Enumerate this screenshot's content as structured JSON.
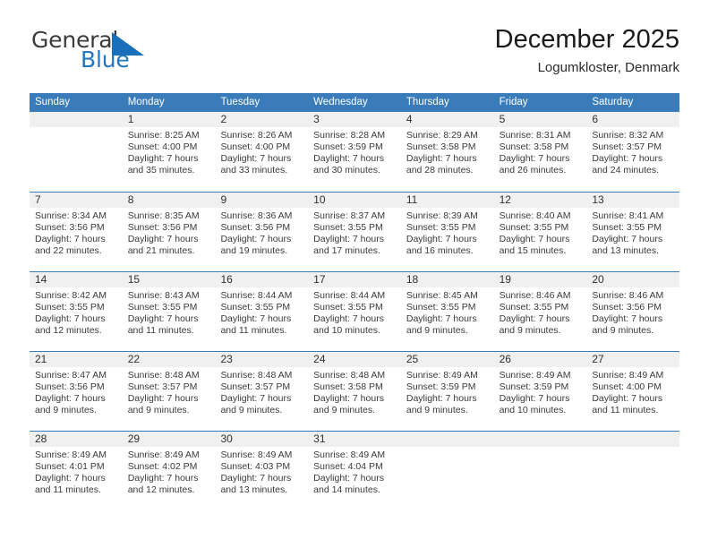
{
  "brand": {
    "name_part1": "General",
    "name_part2": "Blue",
    "mark_icon": "blue-triangle-logo-icon",
    "accent_color": "#2476bd"
  },
  "header": {
    "title": "December 2025",
    "subtitle": "Logumkloster, Denmark"
  },
  "calendar": {
    "header_bg": "#3a7cba",
    "day_band_bg": "#f0f0f0",
    "weekdays": [
      "Sunday",
      "Monday",
      "Tuesday",
      "Wednesday",
      "Thursday",
      "Friday",
      "Saturday"
    ],
    "weeks": [
      [
        {
          "day": "",
          "lines": []
        },
        {
          "day": "1",
          "lines": [
            "Sunrise: 8:25 AM",
            "Sunset: 4:00 PM",
            "Daylight: 7 hours",
            "and 35 minutes."
          ]
        },
        {
          "day": "2",
          "lines": [
            "Sunrise: 8:26 AM",
            "Sunset: 4:00 PM",
            "Daylight: 7 hours",
            "and 33 minutes."
          ]
        },
        {
          "day": "3",
          "lines": [
            "Sunrise: 8:28 AM",
            "Sunset: 3:59 PM",
            "Daylight: 7 hours",
            "and 30 minutes."
          ]
        },
        {
          "day": "4",
          "lines": [
            "Sunrise: 8:29 AM",
            "Sunset: 3:58 PM",
            "Daylight: 7 hours",
            "and 28 minutes."
          ]
        },
        {
          "day": "5",
          "lines": [
            "Sunrise: 8:31 AM",
            "Sunset: 3:58 PM",
            "Daylight: 7 hours",
            "and 26 minutes."
          ]
        },
        {
          "day": "6",
          "lines": [
            "Sunrise: 8:32 AM",
            "Sunset: 3:57 PM",
            "Daylight: 7 hours",
            "and 24 minutes."
          ]
        }
      ],
      [
        {
          "day": "7",
          "lines": [
            "Sunrise: 8:34 AM",
            "Sunset: 3:56 PM",
            "Daylight: 7 hours",
            "and 22 minutes."
          ]
        },
        {
          "day": "8",
          "lines": [
            "Sunrise: 8:35 AM",
            "Sunset: 3:56 PM",
            "Daylight: 7 hours",
            "and 21 minutes."
          ]
        },
        {
          "day": "9",
          "lines": [
            "Sunrise: 8:36 AM",
            "Sunset: 3:56 PM",
            "Daylight: 7 hours",
            "and 19 minutes."
          ]
        },
        {
          "day": "10",
          "lines": [
            "Sunrise: 8:37 AM",
            "Sunset: 3:55 PM",
            "Daylight: 7 hours",
            "and 17 minutes."
          ]
        },
        {
          "day": "11",
          "lines": [
            "Sunrise: 8:39 AM",
            "Sunset: 3:55 PM",
            "Daylight: 7 hours",
            "and 16 minutes."
          ]
        },
        {
          "day": "12",
          "lines": [
            "Sunrise: 8:40 AM",
            "Sunset: 3:55 PM",
            "Daylight: 7 hours",
            "and 15 minutes."
          ]
        },
        {
          "day": "13",
          "lines": [
            "Sunrise: 8:41 AM",
            "Sunset: 3:55 PM",
            "Daylight: 7 hours",
            "and 13 minutes."
          ]
        }
      ],
      [
        {
          "day": "14",
          "lines": [
            "Sunrise: 8:42 AM",
            "Sunset: 3:55 PM",
            "Daylight: 7 hours",
            "and 12 minutes."
          ]
        },
        {
          "day": "15",
          "lines": [
            "Sunrise: 8:43 AM",
            "Sunset: 3:55 PM",
            "Daylight: 7 hours",
            "and 11 minutes."
          ]
        },
        {
          "day": "16",
          "lines": [
            "Sunrise: 8:44 AM",
            "Sunset: 3:55 PM",
            "Daylight: 7 hours",
            "and 11 minutes."
          ]
        },
        {
          "day": "17",
          "lines": [
            "Sunrise: 8:44 AM",
            "Sunset: 3:55 PM",
            "Daylight: 7 hours",
            "and 10 minutes."
          ]
        },
        {
          "day": "18",
          "lines": [
            "Sunrise: 8:45 AM",
            "Sunset: 3:55 PM",
            "Daylight: 7 hours",
            "and 9 minutes."
          ]
        },
        {
          "day": "19",
          "lines": [
            "Sunrise: 8:46 AM",
            "Sunset: 3:55 PM",
            "Daylight: 7 hours",
            "and 9 minutes."
          ]
        },
        {
          "day": "20",
          "lines": [
            "Sunrise: 8:46 AM",
            "Sunset: 3:56 PM",
            "Daylight: 7 hours",
            "and 9 minutes."
          ]
        }
      ],
      [
        {
          "day": "21",
          "lines": [
            "Sunrise: 8:47 AM",
            "Sunset: 3:56 PM",
            "Daylight: 7 hours",
            "and 9 minutes."
          ]
        },
        {
          "day": "22",
          "lines": [
            "Sunrise: 8:48 AM",
            "Sunset: 3:57 PM",
            "Daylight: 7 hours",
            "and 9 minutes."
          ]
        },
        {
          "day": "23",
          "lines": [
            "Sunrise: 8:48 AM",
            "Sunset: 3:57 PM",
            "Daylight: 7 hours",
            "and 9 minutes."
          ]
        },
        {
          "day": "24",
          "lines": [
            "Sunrise: 8:48 AM",
            "Sunset: 3:58 PM",
            "Daylight: 7 hours",
            "and 9 minutes."
          ]
        },
        {
          "day": "25",
          "lines": [
            "Sunrise: 8:49 AM",
            "Sunset: 3:59 PM",
            "Daylight: 7 hours",
            "and 9 minutes."
          ]
        },
        {
          "day": "26",
          "lines": [
            "Sunrise: 8:49 AM",
            "Sunset: 3:59 PM",
            "Daylight: 7 hours",
            "and 10 minutes."
          ]
        },
        {
          "day": "27",
          "lines": [
            "Sunrise: 8:49 AM",
            "Sunset: 4:00 PM",
            "Daylight: 7 hours",
            "and 11 minutes."
          ]
        }
      ],
      [
        {
          "day": "28",
          "lines": [
            "Sunrise: 8:49 AM",
            "Sunset: 4:01 PM",
            "Daylight: 7 hours",
            "and 11 minutes."
          ]
        },
        {
          "day": "29",
          "lines": [
            "Sunrise: 8:49 AM",
            "Sunset: 4:02 PM",
            "Daylight: 7 hours",
            "and 12 minutes."
          ]
        },
        {
          "day": "30",
          "lines": [
            "Sunrise: 8:49 AM",
            "Sunset: 4:03 PM",
            "Daylight: 7 hours",
            "and 13 minutes."
          ]
        },
        {
          "day": "31",
          "lines": [
            "Sunrise: 8:49 AM",
            "Sunset: 4:04 PM",
            "Daylight: 7 hours",
            "and 14 minutes."
          ]
        },
        {
          "day": "",
          "lines": []
        },
        {
          "day": "",
          "lines": []
        },
        {
          "day": "",
          "lines": []
        }
      ]
    ]
  }
}
